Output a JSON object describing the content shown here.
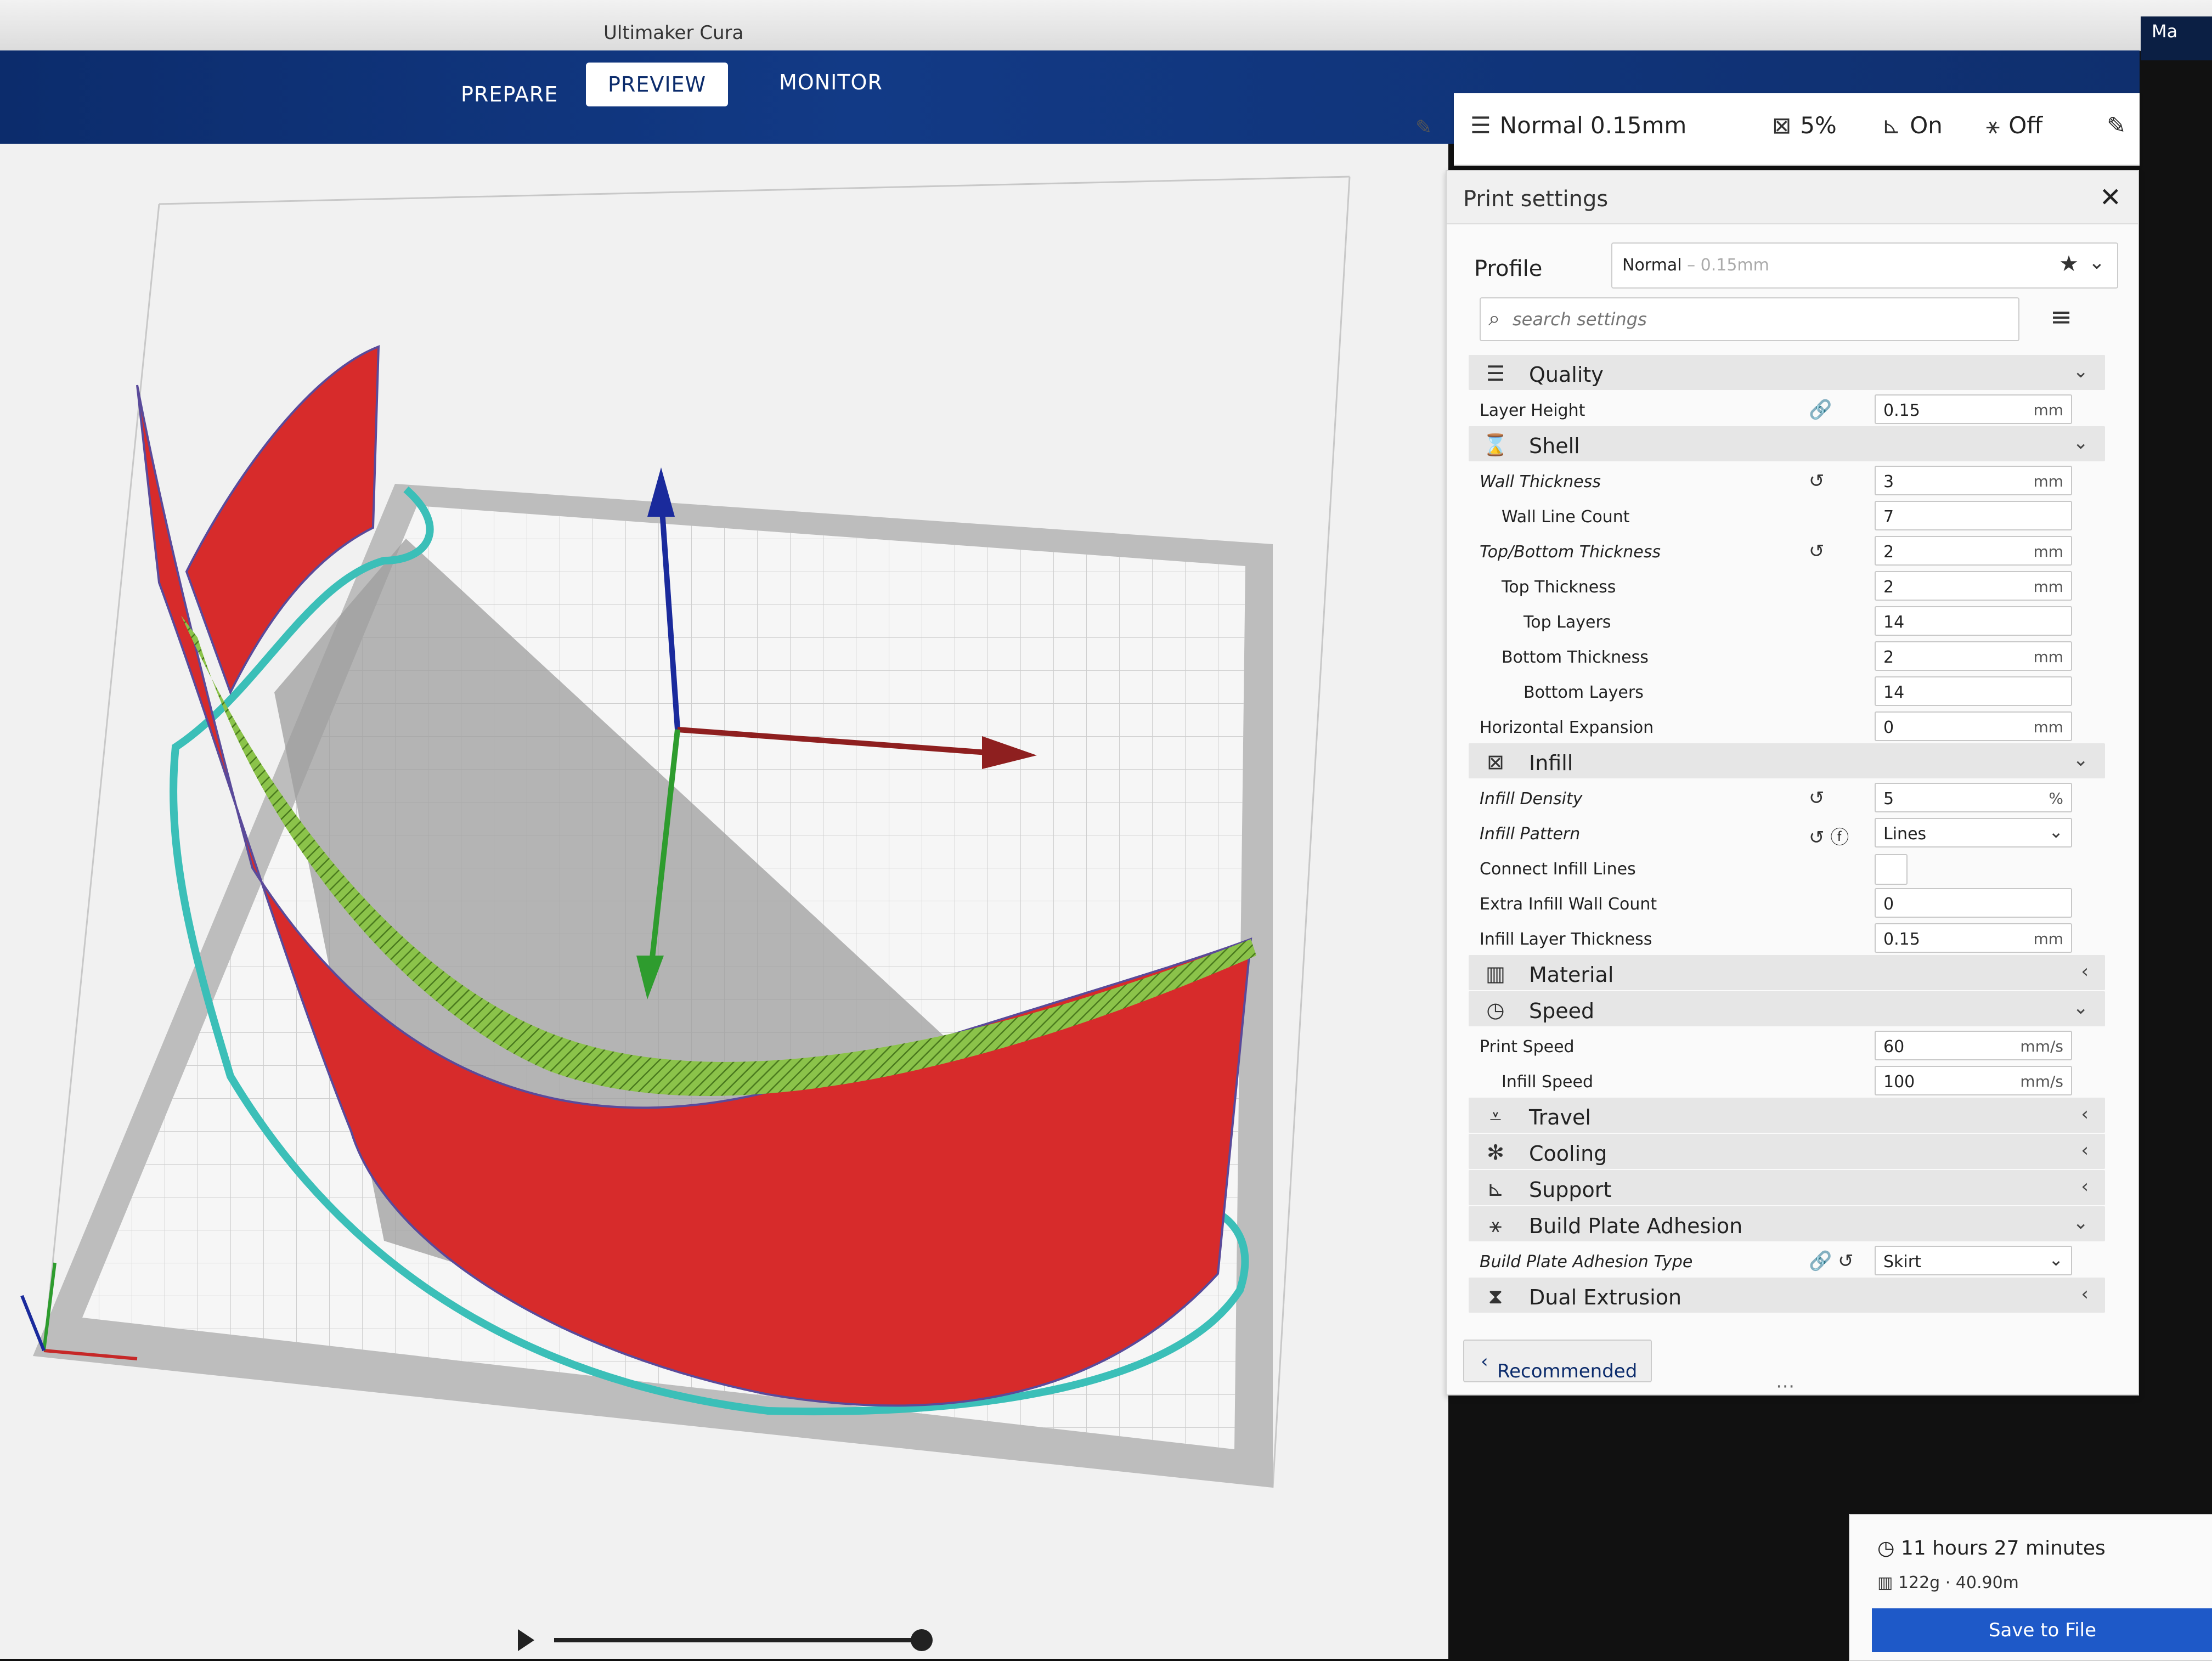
{
  "window": {
    "title": "Ultimaker Cura",
    "corner_label": "Ma"
  },
  "stages": {
    "prepare": "PREPARE",
    "preview": "PREVIEW",
    "monitor": "MONITOR"
  },
  "summary": {
    "profile": "Normal 0.15mm",
    "infill": "5%",
    "support": "On",
    "adhesion": "Off"
  },
  "panel": {
    "title": "Print settings",
    "profile_label": "Profile",
    "profile_name": "Normal",
    "profile_sub": " – 0.15mm",
    "search_placeholder": "search settings",
    "recommended": "Recommended"
  },
  "settings": {
    "quality": "Quality",
    "layer_height": {
      "label": "Layer Height",
      "value": "0.15",
      "unit": "mm"
    },
    "shell": "Shell",
    "wall_thickness": {
      "label": "Wall Thickness",
      "value": "3",
      "unit": "mm"
    },
    "wall_line_count": {
      "label": "Wall Line Count",
      "value": "7"
    },
    "top_bottom_thickness": {
      "label": "Top/Bottom Thickness",
      "value": "2",
      "unit": "mm"
    },
    "top_thickness": {
      "label": "Top Thickness",
      "value": "2",
      "unit": "mm"
    },
    "top_layers": {
      "label": "Top Layers",
      "value": "14"
    },
    "bottom_thickness": {
      "label": "Bottom Thickness",
      "value": "2",
      "unit": "mm"
    },
    "bottom_layers": {
      "label": "Bottom Layers",
      "value": "14"
    },
    "horizontal_expansion": {
      "label": "Horizontal Expansion",
      "value": "0",
      "unit": "mm"
    },
    "infill": "Infill",
    "infill_density": {
      "label": "Infill Density",
      "value": "5",
      "unit": "%"
    },
    "infill_pattern": {
      "label": "Infill Pattern",
      "value": "Lines"
    },
    "connect_infill_lines": {
      "label": "Connect Infill Lines"
    },
    "extra_infill_wall_count": {
      "label": "Extra Infill Wall Count",
      "value": "0"
    },
    "infill_layer_thickness": {
      "label": "Infill Layer Thickness",
      "value": "0.15",
      "unit": "mm"
    },
    "material": "Material",
    "speed": "Speed",
    "print_speed": {
      "label": "Print Speed",
      "value": "60",
      "unit": "mm/s"
    },
    "infill_speed": {
      "label": "Infill Speed",
      "value": "100",
      "unit": "mm/s"
    },
    "travel": "Travel",
    "cooling": "Cooling",
    "support": "Support",
    "build_plate_adhesion": "Build Plate Adhesion",
    "build_plate_adhesion_type": {
      "label": "Build Plate Adhesion Type",
      "value": "Skirt"
    },
    "dual_extrusion": "Dual Extrusion"
  },
  "job": {
    "time": "11 hours 27 minutes",
    "material": "122g · 40.90m",
    "save": "Save to File"
  },
  "colors": {
    "topbar": "#0c2c6c",
    "model": "#d72b2b",
    "skirt": "#3bbfb8",
    "infill": "#8bc34a",
    "save_button": "#1e59c8"
  }
}
